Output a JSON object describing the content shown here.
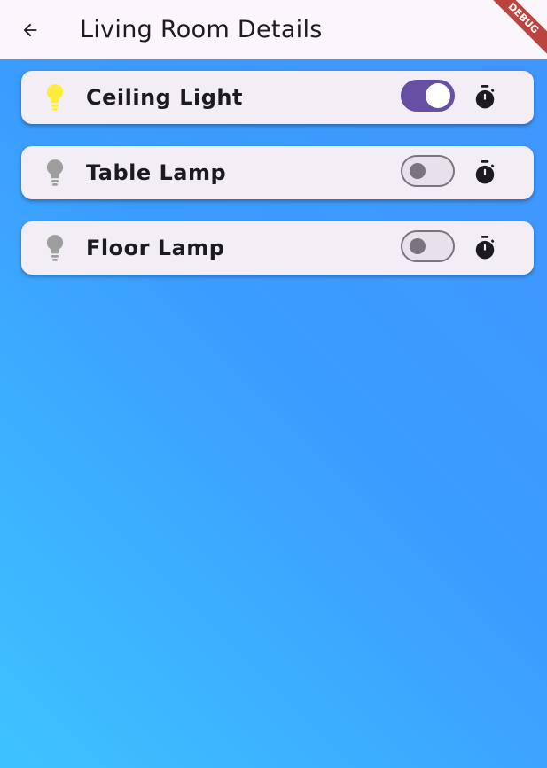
{
  "appbar": {
    "title": "Living Room Details"
  },
  "debug_banner": "DEBUG",
  "colors": {
    "on_bulb": "#ffeb3b",
    "off_bulb": "#9e9e9e",
    "accent": "#6750a4"
  },
  "devices": [
    {
      "name": "Ceiling Light",
      "on": true
    },
    {
      "name": "Table Lamp",
      "on": false
    },
    {
      "name": "Floor Lamp",
      "on": false
    }
  ]
}
